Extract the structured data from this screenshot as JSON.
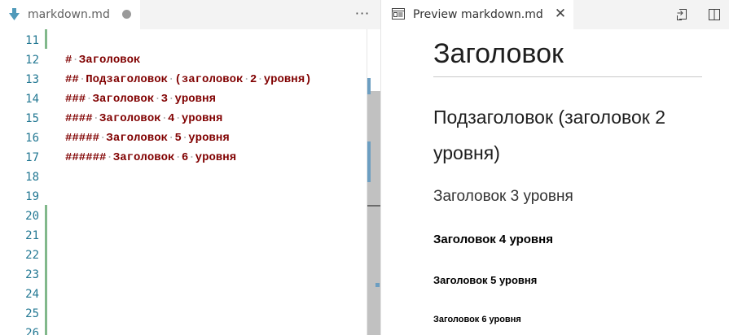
{
  "editor": {
    "tab": {
      "label": "markdown.md",
      "dirty": true
    },
    "more_actions": "···",
    "line_numbers": [
      "11",
      "12",
      "13",
      "14",
      "15",
      "16",
      "17",
      "18",
      "19",
      "20",
      "21",
      "22",
      "23",
      "24",
      "25",
      "26"
    ],
    "lines": [
      "",
      "# Заголовок",
      "## Подзаголовок (заголовок 2 уровня)",
      "### Заголовок 3 уровня",
      "#### Заголовок 4 уровня",
      "##### Заголовок 5 уровня",
      "###### Заголовок 6 уровня",
      "",
      "",
      "",
      "",
      "",
      "",
      "",
      "",
      ""
    ],
    "colors": {
      "markup": "#800000",
      "line_number": "#237893",
      "git_added": "#81b88b"
    }
  },
  "preview": {
    "tab": {
      "label": "Preview markdown.md",
      "close": "✕"
    },
    "icons": [
      "preview-icon",
      "close-icon",
      "open-source-icon",
      "split-editor-icon"
    ],
    "headings": {
      "h1": "Заголовок",
      "h2": "Подзаголовок (заголовок 2 уровня)",
      "h3": "Заголовок 3 уровня",
      "h4": "Заголовок 4 уровня",
      "h5": "Заголовок 5 уровня",
      "h6": "Заголовок 6 уровня"
    }
  }
}
